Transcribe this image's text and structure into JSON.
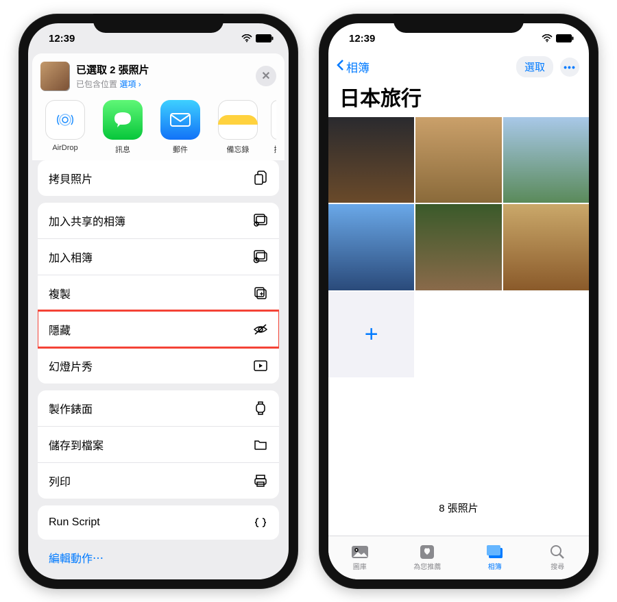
{
  "status": {
    "time": "12:39"
  },
  "left": {
    "share": {
      "title": "已選取 2 張照片",
      "subtitle": "已包含位置",
      "options_label": "選項 ›",
      "close": "✕"
    },
    "apps": {
      "airdrop": "AirDrop",
      "messages": "訊息",
      "mail": "郵件",
      "notes": "備忘錄",
      "reminders_partial": "提"
    },
    "actions": {
      "copy": "拷貝照片",
      "add_shared_album": "加入共享的相簿",
      "add_album": "加入相簿",
      "duplicate": "複製",
      "hide": "隱藏",
      "slideshow": "幻燈片秀",
      "watch_face": "製作錶面",
      "save_files": "儲存到檔案",
      "print": "列印",
      "run_script": "Run Script"
    },
    "edit_actions": "編輯動作⋯"
  },
  "right": {
    "nav": {
      "back": "相簿",
      "select": "選取"
    },
    "album_title": "日本旅行",
    "add_plus": "+",
    "count": "8 張照片",
    "tabs": {
      "library": "圖庫",
      "foryou": "為您推薦",
      "albums": "相簿",
      "search": "搜尋"
    }
  }
}
